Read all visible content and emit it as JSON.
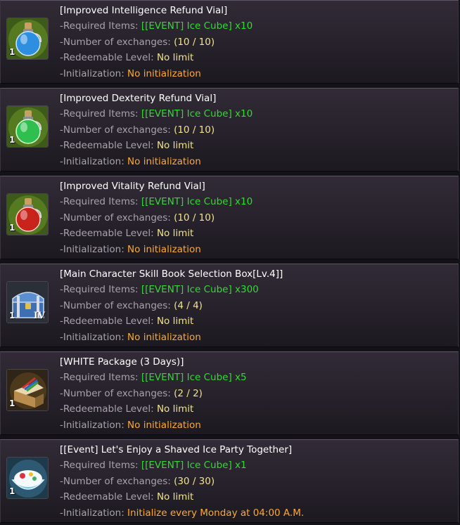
{
  "labels": {
    "required": "-Required Items: ",
    "exchanges": "-Number of exchanges: ",
    "level": "-Redeemable Level: ",
    "init": "-Initialization: "
  },
  "items": [
    {
      "title": "[Improved Intelligence Refund Vial]",
      "required": "[[EVENT] Ice Cube] x10",
      "exchanges": "(10 / 10)",
      "level": "No limit",
      "init": "No initialization",
      "icon": "blue-potion-icon",
      "qty": "1",
      "grade": ""
    },
    {
      "title": "[Improved Dexterity Refund Vial]",
      "required": "[[EVENT] Ice Cube] x10",
      "exchanges": "(10 / 10)",
      "level": "No limit",
      "init": "No initialization",
      "icon": "green-potion-icon",
      "qty": "1",
      "grade": ""
    },
    {
      "title": "[Improved Vitality Refund Vial]",
      "required": "[[EVENT] Ice Cube] x10",
      "exchanges": "(10 / 10)",
      "level": "No limit",
      "init": "No initialization",
      "icon": "red-potion-icon",
      "qty": "1",
      "grade": ""
    },
    {
      "title": "[Main Character Skill Book Selection Box[Lv.4]]",
      "required": "[[EVENT] Ice Cube] x300",
      "exchanges": "(4 / 4)",
      "level": "No limit",
      "init": "No initialization",
      "icon": "treasure-chest-icon",
      "qty": "1",
      "grade": "IV"
    },
    {
      "title": "[WHITE Package (3 Days)]",
      "required": "[[EVENT] Ice Cube] x5",
      "exchanges": "(2 / 2)",
      "level": "No limit",
      "init": "No initialization",
      "icon": "package-box-icon",
      "qty": "1",
      "grade": ""
    },
    {
      "title": "[[Event] Let's Enjoy a Shaved Ice Party Together]",
      "required": "[[EVENT] Ice Cube] x1",
      "exchanges": "(30 / 30)",
      "level": "No limit",
      "init": "Initialize every Monday at 04:00 A.M.",
      "icon": "shaved-ice-icon",
      "qty": "1",
      "grade": ""
    }
  ],
  "colors": {
    "required_value": "#2fdc2f",
    "init_value": "#ffa832",
    "label": "#a8a2ad",
    "potion_blue": "#2e8fe0",
    "potion_green": "#2fbf4f",
    "potion_red": "#c8241c"
  }
}
